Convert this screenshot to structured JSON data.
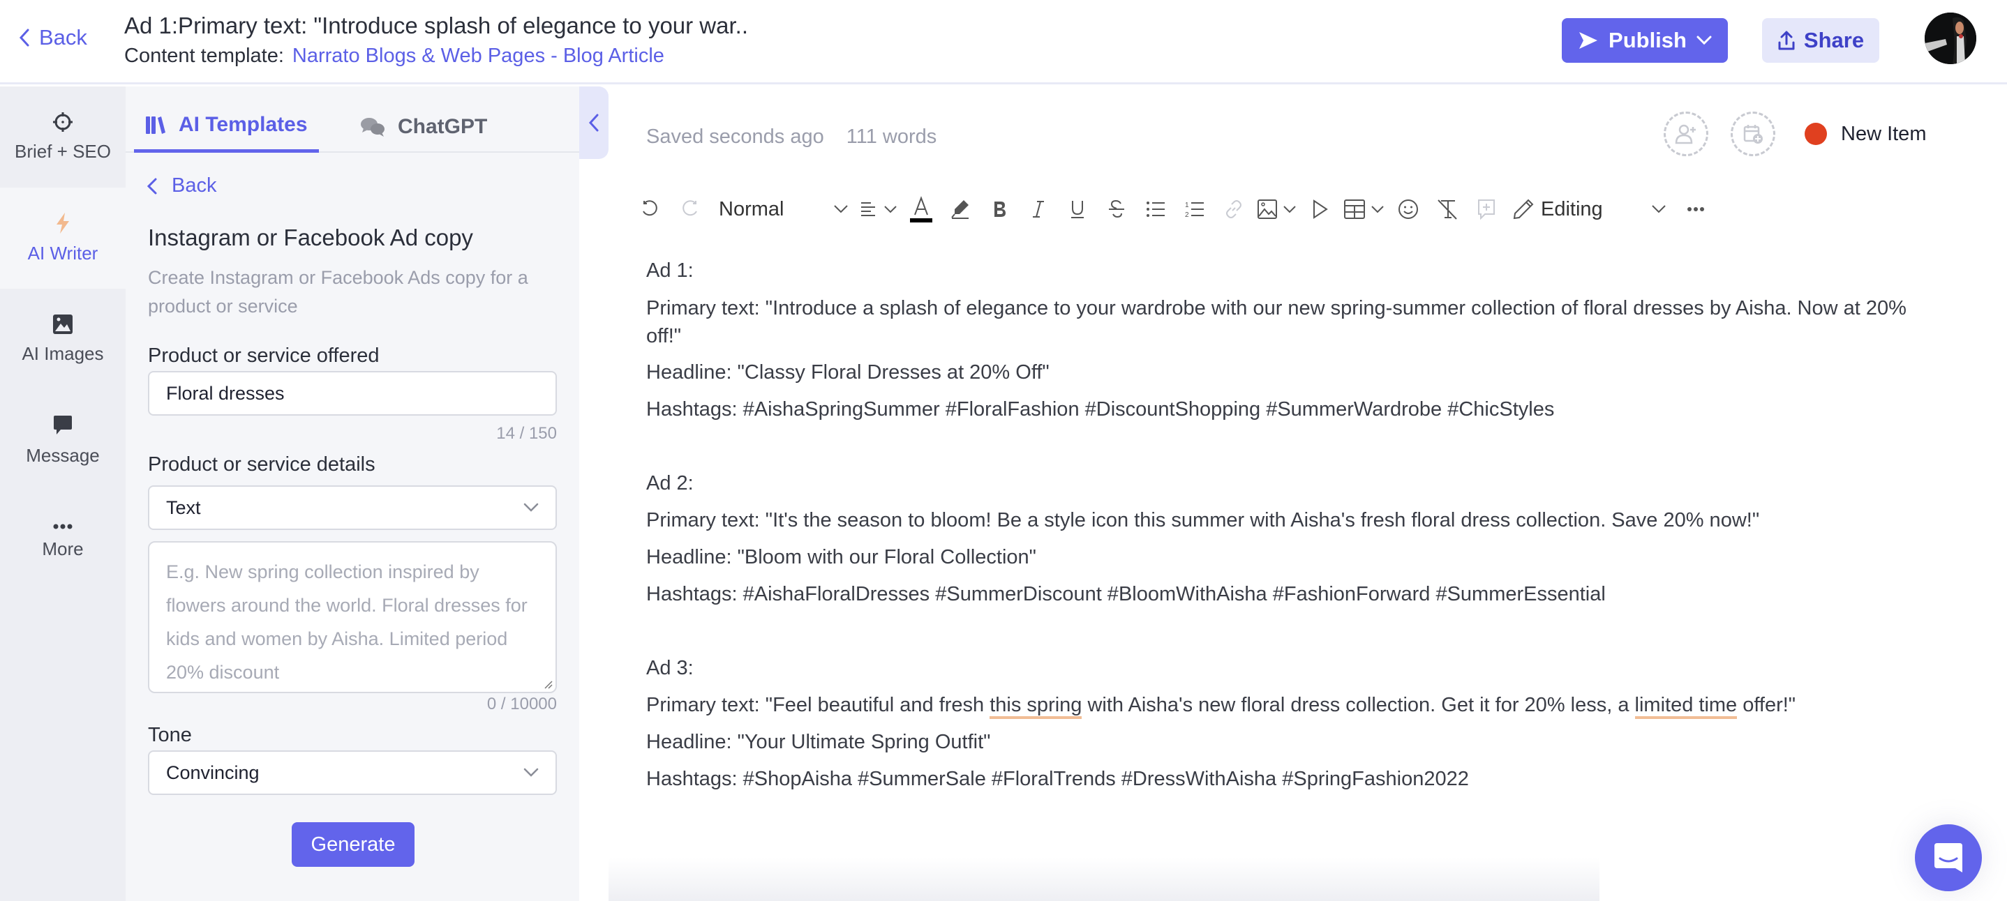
{
  "header": {
    "back_label": "Back",
    "title": "Ad 1:Primary text: \"Introduce splash of elegance to your war..",
    "template_prefix": "Content template:",
    "template_link": "Narrato Blogs & Web Pages - Blog Article",
    "publish_label": "Publish",
    "share_label": "Share"
  },
  "sidebar": {
    "items": [
      {
        "label": "Brief + SEO",
        "icon": "crosshair-icon"
      },
      {
        "label": "AI Writer",
        "icon": "lightning-icon",
        "active": true
      },
      {
        "label": "AI Images",
        "icon": "image-icon"
      },
      {
        "label": "Message",
        "icon": "message-icon"
      },
      {
        "label": "More",
        "icon": "more-icon"
      }
    ]
  },
  "panel": {
    "tabs": [
      {
        "label": "AI Templates",
        "active": true
      },
      {
        "label": "ChatGPT"
      }
    ],
    "back_label": "Back",
    "title": "Instagram or Facebook Ad copy",
    "description": "Create Instagram or Facebook Ads copy for a product or service",
    "fields": {
      "product_label": "Product or service offered",
      "product_value": "Floral dresses",
      "product_counter": "14 / 150",
      "details_label": "Product or service details",
      "details_type": "Text",
      "details_placeholder": "E.g. New spring collection inspired by flowers around the world. Floral dresses for kids and women by Aisha. Limited period 20% discount",
      "details_counter": "0 / 10000",
      "tone_label": "Tone",
      "tone_value": "Convincing"
    },
    "generate_label": "Generate"
  },
  "editor": {
    "saved_status": "Saved seconds ago",
    "word_count": "111 words",
    "status_label": "New Item",
    "status_color": "#e0401f",
    "toolbar": {
      "style_value": "Normal",
      "mode_value": "Editing",
      "font_color": "#000000"
    },
    "ads": [
      {
        "heading": "Ad 1:",
        "primary": "Primary text: \"Introduce a splash of elegance to your wardrobe with our new spring-summer collection of floral dresses by Aisha. Now at 20% off!\"",
        "headline": "Headline: \"Classy Floral Dresses at 20% Off\"",
        "hashtags": "Hashtags: #AishaSpringSummer #FloralFashion #DiscountShopping #SummerWardrobe #ChicStyles"
      },
      {
        "heading": "Ad 2:",
        "primary": "Primary text: \"It's the season to bloom! Be a style icon this summer with Aisha's fresh floral dress collection. Save 20% now!\"",
        "headline": "Headline: \"Bloom with our Floral Collection\"",
        "hashtags": "Hashtags: #AishaFloralDresses #SummerDiscount #BloomWithAisha #FashionForward #SummerEssential"
      },
      {
        "heading": "Ad 3:",
        "primary_parts": [
          "Primary text: \"Feel beautiful and fresh ",
          "this spring",
          " with Aisha's new floral dress collection. Get it for 20% less, a ",
          "limited time",
          " offer!\""
        ],
        "headline": "Headline: \"Your Ultimate Spring Outfit\"",
        "hashtags": "Hashtags: #ShopAisha #SummerSale #FloralTrends #DressWithAisha #SpringFashion2022"
      }
    ]
  },
  "colors": {
    "accent": "#6264eb",
    "accent_text": "#5b5fe6",
    "share_bg": "#e5e7fa",
    "spellcheck_underline": "#f1bd95",
    "ai_writer_icon": "#f2b98e"
  }
}
